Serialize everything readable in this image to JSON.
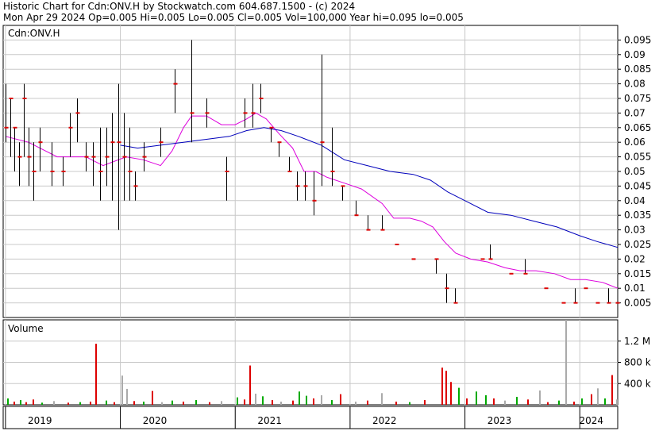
{
  "header": {
    "line1": "Historic Chart for Cdn:ONV.H by Stockwatch.com 604.687.1500 - (c) 2024",
    "line2": "Mon Apr 29 2024   Op=0.005   Hi=0.005   Lo=0.005   Cl=0.005   Vol=100,000   Year hi=0.095   lo=0.005"
  },
  "colors": {
    "price_bar": "#000000",
    "close_tick": "#dd0000",
    "ma_short": "#dd00dd",
    "ma_long": "#0000bb",
    "vol_up": "#00aa00",
    "vol_down": "#dd0000",
    "vol_flat": "#aaaaaa",
    "grid": "#c8c8c8"
  },
  "chart_data": [
    {
      "type": "candlestick",
      "title": "Cdn:ONV.H",
      "ylim": [
        0.0,
        0.1
      ],
      "y_ticks": [
        0.005,
        0.01,
        0.015,
        0.02,
        0.025,
        0.03,
        0.035,
        0.04,
        0.045,
        0.05,
        0.055,
        0.06,
        0.065,
        0.07,
        0.075,
        0.08,
        0.085,
        0.09,
        0.095
      ],
      "y_tick_labels": [
        "0.005",
        "0.01",
        "0.015",
        "0.02",
        "0.025",
        "0.03",
        "0.035",
        "0.04",
        "0.045",
        "0.05",
        "0.055",
        "0.06",
        "0.065",
        "0.07",
        "0.075",
        "0.08",
        "0.085",
        "0.09",
        "0.095"
      ],
      "x_range": [
        2018.98,
        2024.33
      ],
      "grid": true,
      "bars": [
        {
          "x": 2019.0,
          "high": 0.08,
          "low": 0.06,
          "close": 0.065
        },
        {
          "x": 2019.04,
          "high": 0.075,
          "low": 0.055,
          "close": 0.075
        },
        {
          "x": 2019.08,
          "high": 0.065,
          "low": 0.05,
          "close": 0.065
        },
        {
          "x": 2019.12,
          "high": 0.06,
          "low": 0.045,
          "close": 0.055
        },
        {
          "x": 2019.16,
          "high": 0.08,
          "low": 0.055,
          "close": 0.075
        },
        {
          "x": 2019.2,
          "high": 0.065,
          "low": 0.045,
          "close": 0.055
        },
        {
          "x": 2019.24,
          "high": 0.06,
          "low": 0.04,
          "close": 0.05
        },
        {
          "x": 2019.3,
          "high": 0.065,
          "low": 0.05,
          "close": 0.06
        },
        {
          "x": 2019.4,
          "high": 0.06,
          "low": 0.045,
          "close": 0.05
        },
        {
          "x": 2019.5,
          "high": 0.055,
          "low": 0.045,
          "close": 0.05
        },
        {
          "x": 2019.56,
          "high": 0.07,
          "low": 0.055,
          "close": 0.065
        },
        {
          "x": 2019.62,
          "high": 0.075,
          "low": 0.06,
          "close": 0.07
        },
        {
          "x": 2019.7,
          "high": 0.06,
          "low": 0.05,
          "close": 0.055
        },
        {
          "x": 2019.76,
          "high": 0.06,
          "low": 0.045,
          "close": 0.055
        },
        {
          "x": 2019.82,
          "high": 0.065,
          "low": 0.04,
          "close": 0.05
        },
        {
          "x": 2019.88,
          "high": 0.065,
          "low": 0.045,
          "close": 0.055
        },
        {
          "x": 2019.93,
          "high": 0.07,
          "low": 0.04,
          "close": 0.06
        },
        {
          "x": 2019.98,
          "high": 0.08,
          "low": 0.03,
          "close": 0.06
        },
        {
          "x": 2020.03,
          "high": 0.07,
          "low": 0.04,
          "close": 0.055
        },
        {
          "x": 2020.08,
          "high": 0.065,
          "low": 0.04,
          "close": 0.05
        },
        {
          "x": 2020.13,
          "high": 0.05,
          "low": 0.04,
          "close": 0.045
        },
        {
          "x": 2020.2,
          "high": 0.06,
          "low": 0.05,
          "close": 0.055
        },
        {
          "x": 2020.35,
          "high": 0.065,
          "low": 0.055,
          "close": 0.06
        },
        {
          "x": 2020.47,
          "high": 0.085,
          "low": 0.07,
          "close": 0.08
        },
        {
          "x": 2020.62,
          "high": 0.095,
          "low": 0.06,
          "close": 0.07
        },
        {
          "x": 2020.75,
          "high": 0.075,
          "low": 0.065,
          "close": 0.07
        },
        {
          "x": 2020.92,
          "high": 0.055,
          "low": 0.04,
          "close": 0.05
        },
        {
          "x": 2021.08,
          "high": 0.075,
          "low": 0.065,
          "close": 0.07
        },
        {
          "x": 2021.15,
          "high": 0.08,
          "low": 0.065,
          "close": 0.07
        },
        {
          "x": 2021.22,
          "high": 0.08,
          "low": 0.07,
          "close": 0.075
        },
        {
          "x": 2021.31,
          "high": 0.065,
          "low": 0.06,
          "close": 0.065
        },
        {
          "x": 2021.38,
          "high": 0.06,
          "low": 0.055,
          "close": 0.06
        },
        {
          "x": 2021.47,
          "high": 0.055,
          "low": 0.05,
          "close": 0.05
        },
        {
          "x": 2021.54,
          "high": 0.05,
          "low": 0.04,
          "close": 0.045
        },
        {
          "x": 2021.61,
          "high": 0.05,
          "low": 0.04,
          "close": 0.045
        },
        {
          "x": 2021.68,
          "high": 0.05,
          "low": 0.035,
          "close": 0.04
        },
        {
          "x": 2021.75,
          "high": 0.09,
          "low": 0.045,
          "close": 0.06
        },
        {
          "x": 2021.84,
          "high": 0.065,
          "low": 0.045,
          "close": 0.05
        },
        {
          "x": 2021.93,
          "high": 0.045,
          "low": 0.04,
          "close": 0.045
        },
        {
          "x": 2022.05,
          "high": 0.04,
          "low": 0.035,
          "close": 0.035
        },
        {
          "x": 2022.15,
          "high": 0.035,
          "low": 0.03,
          "close": 0.03
        },
        {
          "x": 2022.28,
          "high": 0.035,
          "low": 0.03,
          "close": 0.03
        },
        {
          "x": 2022.4,
          "high": 0.025,
          "low": 0.025,
          "close": 0.025
        },
        {
          "x": 2022.55,
          "high": 0.02,
          "low": 0.02,
          "close": 0.02
        },
        {
          "x": 2022.75,
          "high": 0.02,
          "low": 0.015,
          "close": 0.02
        },
        {
          "x": 2022.84,
          "high": 0.015,
          "low": 0.005,
          "close": 0.01
        },
        {
          "x": 2022.91,
          "high": 0.01,
          "low": 0.005,
          "close": 0.005
        },
        {
          "x": 2023.15,
          "high": 0.02,
          "low": 0.02,
          "close": 0.02
        },
        {
          "x": 2023.22,
          "high": 0.025,
          "low": 0.02,
          "close": 0.02
        },
        {
          "x": 2023.4,
          "high": 0.015,
          "low": 0.015,
          "close": 0.015
        },
        {
          "x": 2023.52,
          "high": 0.02,
          "low": 0.015,
          "close": 0.015
        },
        {
          "x": 2023.7,
          "high": 0.01,
          "low": 0.01,
          "close": 0.01
        },
        {
          "x": 2023.85,
          "high": 0.005,
          "low": 0.005,
          "close": 0.005
        },
        {
          "x": 2023.96,
          "high": 0.01,
          "low": 0.005,
          "close": 0.005
        },
        {
          "x": 2024.05,
          "high": 0.01,
          "low": 0.01,
          "close": 0.01
        },
        {
          "x": 2024.15,
          "high": 0.005,
          "low": 0.005,
          "close": 0.005
        },
        {
          "x": 2024.25,
          "high": 0.01,
          "low": 0.005,
          "close": 0.005
        },
        {
          "x": 2024.32,
          "high": 0.005,
          "low": 0.005,
          "close": 0.005
        }
      ],
      "series": [
        {
          "type": "line",
          "color": "#dd00dd",
          "x": [
            2019.0,
            2019.2,
            2019.45,
            2019.7,
            2019.85,
            2020.05,
            2020.2,
            2020.35,
            2020.45,
            2020.55,
            2020.62,
            2020.75,
            2020.88,
            2021.0,
            2021.1,
            2021.18,
            2021.27,
            2021.38,
            2021.5,
            2021.6,
            2021.7,
            2021.8,
            2021.95,
            2022.1,
            2022.28,
            2022.38,
            2022.52,
            2022.62,
            2022.72,
            2022.82,
            2022.92,
            2023.05,
            2023.2,
            2023.35,
            2023.48,
            2023.62,
            2023.78,
            2023.92,
            2024.05,
            2024.2,
            2024.33
          ],
          "y": [
            0.062,
            0.06,
            0.055,
            0.055,
            0.052,
            0.055,
            0.054,
            0.052,
            0.057,
            0.065,
            0.069,
            0.069,
            0.066,
            0.066,
            0.068,
            0.07,
            0.068,
            0.063,
            0.058,
            0.05,
            0.05,
            0.048,
            0.046,
            0.044,
            0.039,
            0.034,
            0.034,
            0.033,
            0.031,
            0.026,
            0.022,
            0.02,
            0.019,
            0.017,
            0.016,
            0.016,
            0.015,
            0.013,
            0.013,
            0.012,
            0.01
          ]
        },
        {
          "type": "line",
          "color": "#0000bb",
          "x": [
            2020.0,
            2020.15,
            2020.35,
            2020.55,
            2020.75,
            2020.95,
            2021.1,
            2021.25,
            2021.4,
            2021.55,
            2021.75,
            2021.95,
            2022.15,
            2022.35,
            2022.55,
            2022.7,
            2022.85,
            2023.0,
            2023.2,
            2023.4,
            2023.6,
            2023.8,
            2024.0,
            2024.15,
            2024.33
          ],
          "y": [
            0.059,
            0.058,
            0.059,
            0.06,
            0.061,
            0.062,
            0.064,
            0.065,
            0.064,
            0.062,
            0.059,
            0.054,
            0.052,
            0.05,
            0.049,
            0.047,
            0.043,
            0.04,
            0.036,
            0.035,
            0.033,
            0.031,
            0.028,
            0.026,
            0.024
          ]
        }
      ]
    },
    {
      "type": "bar",
      "title": "Volume",
      "ylim": [
        0,
        1600000
      ],
      "y_ticks": [
        400000,
        800000,
        1200000
      ],
      "y_tick_labels": [
        "400 k",
        "800 k",
        "1.2 M"
      ],
      "x_range": [
        2018.98,
        2024.33
      ],
      "grid": true,
      "bars": [
        {
          "x": 2019.02,
          "v": 120000,
          "dir": "up"
        },
        {
          "x": 2019.08,
          "v": 60000,
          "dir": "down"
        },
        {
          "x": 2019.13,
          "v": 90000,
          "dir": "up"
        },
        {
          "x": 2019.18,
          "v": 50000,
          "dir": "down"
        },
        {
          "x": 2019.24,
          "v": 100000,
          "dir": "down"
        },
        {
          "x": 2019.32,
          "v": 40000,
          "dir": "up"
        },
        {
          "x": 2019.42,
          "v": 70000,
          "dir": "flat"
        },
        {
          "x": 2019.55,
          "v": 40000,
          "dir": "down"
        },
        {
          "x": 2019.65,
          "v": 50000,
          "dir": "up"
        },
        {
          "x": 2019.74,
          "v": 60000,
          "dir": "down"
        },
        {
          "x": 2019.79,
          "v": 1150000,
          "dir": "down"
        },
        {
          "x": 2019.88,
          "v": 80000,
          "dir": "up"
        },
        {
          "x": 2019.95,
          "v": 50000,
          "dir": "down"
        },
        {
          "x": 2020.02,
          "v": 550000,
          "dir": "flat"
        },
        {
          "x": 2020.06,
          "v": 300000,
          "dir": "flat"
        },
        {
          "x": 2020.12,
          "v": 70000,
          "dir": "down"
        },
        {
          "x": 2020.2,
          "v": 60000,
          "dir": "up"
        },
        {
          "x": 2020.28,
          "v": 260000,
          "dir": "down"
        },
        {
          "x": 2020.36,
          "v": 50000,
          "dir": "flat"
        },
        {
          "x": 2020.45,
          "v": 80000,
          "dir": "up"
        },
        {
          "x": 2020.55,
          "v": 60000,
          "dir": "down"
        },
        {
          "x": 2020.66,
          "v": 90000,
          "dir": "up"
        },
        {
          "x": 2020.78,
          "v": 50000,
          "dir": "down"
        },
        {
          "x": 2020.88,
          "v": 70000,
          "dir": "flat"
        },
        {
          "x": 2021.02,
          "v": 140000,
          "dir": "up"
        },
        {
          "x": 2021.08,
          "v": 100000,
          "dir": "down"
        },
        {
          "x": 2021.13,
          "v": 740000,
          "dir": "down"
        },
        {
          "x": 2021.18,
          "v": 210000,
          "dir": "flat"
        },
        {
          "x": 2021.24,
          "v": 160000,
          "dir": "up"
        },
        {
          "x": 2021.32,
          "v": 90000,
          "dir": "down"
        },
        {
          "x": 2021.4,
          "v": 60000,
          "dir": "flat"
        },
        {
          "x": 2021.5,
          "v": 80000,
          "dir": "down"
        },
        {
          "x": 2021.56,
          "v": 250000,
          "dir": "up"
        },
        {
          "x": 2021.62,
          "v": 170000,
          "dir": "up"
        },
        {
          "x": 2021.68,
          "v": 120000,
          "dir": "down"
        },
        {
          "x": 2021.75,
          "v": 180000,
          "dir": "flat"
        },
        {
          "x": 2021.84,
          "v": 90000,
          "dir": "up"
        },
        {
          "x": 2021.92,
          "v": 200000,
          "dir": "down"
        },
        {
          "x": 2022.05,
          "v": 60000,
          "dir": "flat"
        },
        {
          "x": 2022.15,
          "v": 80000,
          "dir": "down"
        },
        {
          "x": 2022.28,
          "v": 220000,
          "dir": "flat"
        },
        {
          "x": 2022.4,
          "v": 60000,
          "dir": "down"
        },
        {
          "x": 2022.52,
          "v": 50000,
          "dir": "up"
        },
        {
          "x": 2022.65,
          "v": 90000,
          "dir": "down"
        },
        {
          "x": 2022.8,
          "v": 700000,
          "dir": "down"
        },
        {
          "x": 2022.84,
          "v": 640000,
          "dir": "down"
        },
        {
          "x": 2022.88,
          "v": 430000,
          "dir": "down"
        },
        {
          "x": 2022.95,
          "v": 320000,
          "dir": "up"
        },
        {
          "x": 2023.02,
          "v": 120000,
          "dir": "down"
        },
        {
          "x": 2023.1,
          "v": 250000,
          "dir": "up"
        },
        {
          "x": 2023.18,
          "v": 180000,
          "dir": "up"
        },
        {
          "x": 2023.25,
          "v": 120000,
          "dir": "down"
        },
        {
          "x": 2023.35,
          "v": 80000,
          "dir": "flat"
        },
        {
          "x": 2023.45,
          "v": 150000,
          "dir": "up"
        },
        {
          "x": 2023.55,
          "v": 100000,
          "dir": "down"
        },
        {
          "x": 2023.65,
          "v": 270000,
          "dir": "flat"
        },
        {
          "x": 2023.72,
          "v": 50000,
          "dir": "down"
        },
        {
          "x": 2023.82,
          "v": 80000,
          "dir": "up"
        },
        {
          "x": 2023.88,
          "v": 1600000,
          "dir": "flat"
        },
        {
          "x": 2023.95,
          "v": 60000,
          "dir": "down"
        },
        {
          "x": 2024.02,
          "v": 120000,
          "dir": "up"
        },
        {
          "x": 2024.1,
          "v": 200000,
          "dir": "down"
        },
        {
          "x": 2024.16,
          "v": 310000,
          "dir": "flat"
        },
        {
          "x": 2024.22,
          "v": 120000,
          "dir": "up"
        },
        {
          "x": 2024.28,
          "v": 560000,
          "dir": "down"
        },
        {
          "x": 2024.32,
          "v": 100000,
          "dir": "flat"
        }
      ]
    },
    {
      "type": "axis",
      "x_ticks": [
        2019.0,
        2020.0,
        2021.0,
        2022.0,
        2023.0,
        2024.0
      ],
      "x_tick_labels": [
        "2019",
        "2020",
        "2021",
        "2022",
        "2023",
        "2024"
      ],
      "x_label_positions": [
        2019.3,
        2020.3,
        2021.3,
        2022.3,
        2023.3,
        2024.1
      ]
    }
  ]
}
